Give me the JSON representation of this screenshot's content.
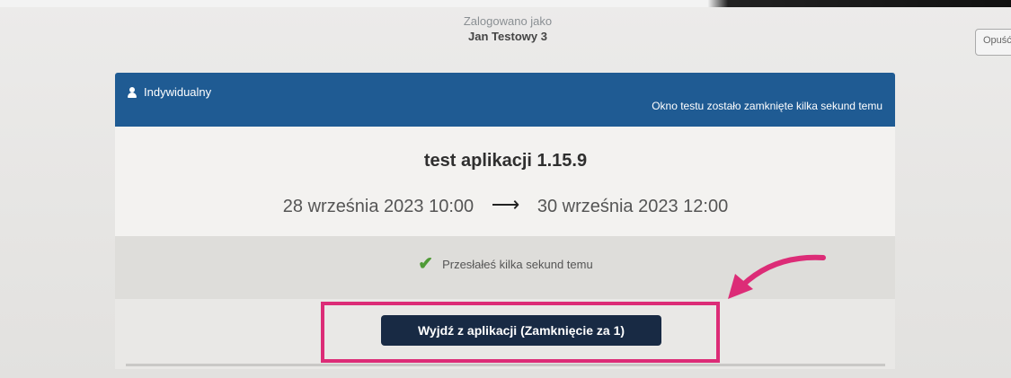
{
  "header": {
    "login_label": "Zalogowano jako",
    "user_name": "Jan Testowy 3",
    "top_button_label": "Opuść"
  },
  "card": {
    "mode_label": "Indywidualny",
    "mode_icon": "user-icon",
    "window_status": "Okno testu zostało zamknięte kilka sekund temu",
    "test_name": "test aplikacji 1.15.9",
    "start_date": "28 września 2023 10:00",
    "end_date": "30 września 2023 12:00",
    "date_arrow": "⟶",
    "submission_status": "Przesłałeś kilka sekund temu",
    "exit_button_label": "Wyjdź z aplikacji (Zamknięcie za 1)"
  },
  "colors": {
    "header_bg": "#1f5b93",
    "button_bg": "#182a44",
    "check": "#4f9a36",
    "annotation": "#dc2c77"
  }
}
